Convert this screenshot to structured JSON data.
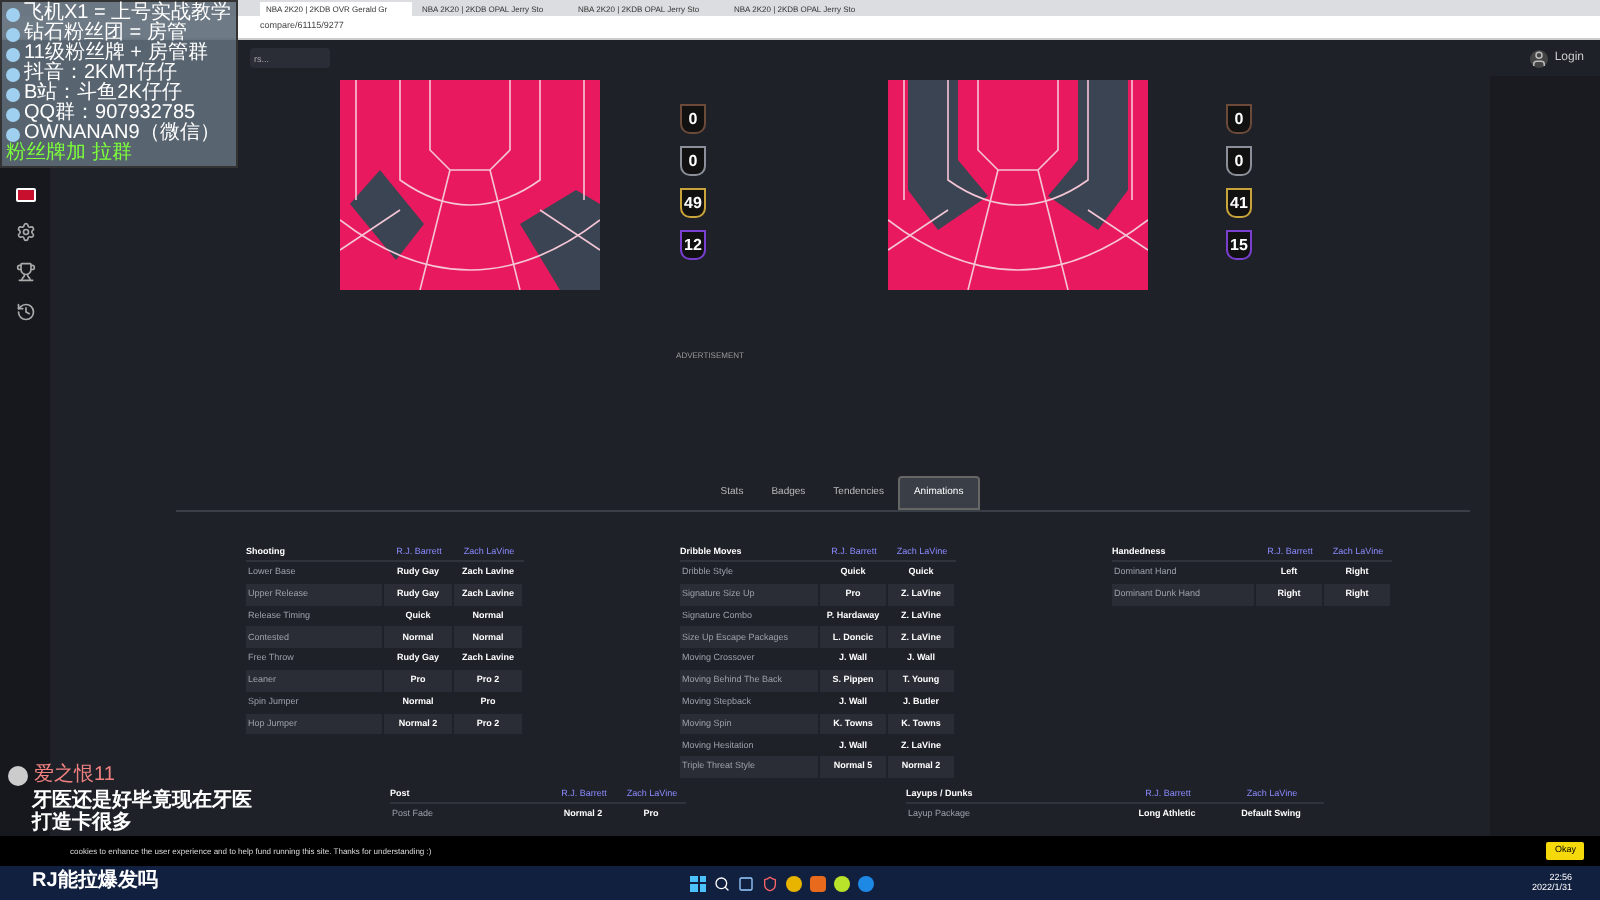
{
  "browser": {
    "tabs": [
      {
        "label": "NBA 2K20 | 2KDB OVR Gerald Gr",
        "selected": true
      },
      {
        "label": "NBA 2K20 | 2KDB OPAL Jerry Sto",
        "selected": false
      },
      {
        "label": "NBA 2K20 | 2KDB OPAL Jerry Sto",
        "selected": false
      },
      {
        "label": "NBA 2K20 | 2KDB OPAL Jerry Sto",
        "selected": false
      }
    ],
    "url": "compare/61115/9277"
  },
  "header": {
    "search": {
      "placeholder": "rs..."
    },
    "login": "Login"
  },
  "players": [
    {
      "badges": [
        {
          "count": "0",
          "color": "#6b4a3a"
        },
        {
          "count": "0",
          "color": "#8a8f99"
        },
        {
          "count": "49",
          "color": "#c9a43a"
        },
        {
          "count": "12",
          "color": "#7a3fd1"
        }
      ]
    },
    {
      "badges": [
        {
          "count": "0",
          "color": "#6b4a3a"
        },
        {
          "count": "0",
          "color": "#8a8f99"
        },
        {
          "count": "41",
          "color": "#c9a43a"
        },
        {
          "count": "15",
          "color": "#7a3fd1"
        }
      ]
    }
  ],
  "advertisement": "ADVERTISEMENT",
  "tabs": [
    {
      "label": "Stats",
      "selected": false
    },
    {
      "label": "Badges",
      "selected": false
    },
    {
      "label": "Tendencies",
      "selected": false
    },
    {
      "label": "Animations",
      "selected": true
    }
  ],
  "tables": [
    {
      "title": "Shooting",
      "players": [
        "R.J. Barrett",
        "Zach LaVine"
      ],
      "rows": [
        {
          "label": "Lower Base",
          "values": [
            "Rudy Gay",
            "Zach Lavine"
          ]
        },
        {
          "label": "Upper Release",
          "values": [
            "Rudy Gay",
            "Zach Lavine"
          ]
        },
        {
          "label": "Release Timing",
          "values": [
            "Quick",
            "Normal"
          ]
        },
        {
          "label": "Contested",
          "values": [
            "Normal",
            "Normal"
          ]
        },
        {
          "label": "Free Throw",
          "values": [
            "Rudy Gay",
            "Zach Lavine"
          ]
        },
        {
          "label": "Leaner",
          "values": [
            "Pro",
            "Pro 2"
          ]
        },
        {
          "label": "Spin Jumper",
          "values": [
            "Normal",
            "Pro"
          ]
        },
        {
          "label": "Hop Jumper",
          "values": [
            "Normal 2",
            "Pro 2"
          ]
        }
      ]
    },
    {
      "title": "Dribble Moves",
      "players": [
        "R.J. Barrett",
        "Zach LaVine"
      ],
      "rows": [
        {
          "label": "Dribble Style",
          "values": [
            "Quick",
            "Quick"
          ]
        },
        {
          "label": "Signature Size Up",
          "values": [
            "Pro",
            "Z. LaVine"
          ]
        },
        {
          "label": "Signature Combo",
          "values": [
            "P. Hardaway",
            "Z. LaVine"
          ]
        },
        {
          "label": "Size Up Escape Packages",
          "values": [
            "L. Doncic",
            "Z. LaVine"
          ]
        },
        {
          "label": "Moving Crossover",
          "values": [
            "J. Wall",
            "J. Wall"
          ]
        },
        {
          "label": "Moving Behind The Back",
          "values": [
            "S. Pippen",
            "T. Young"
          ]
        },
        {
          "label": "Moving Stepback",
          "values": [
            "J. Wall",
            "J. Butler"
          ]
        },
        {
          "label": "Moving Spin",
          "values": [
            "K. Towns",
            "K. Towns"
          ]
        },
        {
          "label": "Moving Hesitation",
          "values": [
            "J. Wall",
            "Z. LaVine"
          ]
        },
        {
          "label": "Triple Threat Style",
          "values": [
            "Normal 5",
            "Normal 2"
          ]
        }
      ]
    },
    {
      "title": "Handedness",
      "players": [
        "R.J. Barrett",
        "Zach LaVine"
      ],
      "rows": [
        {
          "label": "Dominant Hand",
          "values": [
            "Left",
            "Right"
          ]
        },
        {
          "label": "Dominant Dunk Hand",
          "values": [
            "Right",
            "Right"
          ]
        }
      ]
    },
    {
      "title": "Post",
      "players": [
        "R.J. Barrett",
        "Zach LaVine"
      ],
      "rows": [
        {
          "label": "Post Fade",
          "values": [
            "Normal 2",
            "Pro"
          ]
        }
      ]
    },
    {
      "title": "Layups / Dunks",
      "players": [
        "R.J. Barrett",
        "Zach LaVine"
      ],
      "rows": [
        {
          "label": "Layup Package",
          "values": [
            "Long Athletic",
            "Default Swing"
          ]
        }
      ]
    }
  ],
  "cookie_banner": {
    "text": "cookies to enhance the user experience and to help fund running this site. Thanks for understanding :)",
    "button": "Okay"
  },
  "stream_overlay": {
    "lines": [
      "飞机X1 = 上号实战教学",
      "钻石粉丝团 = 房管",
      "11级粉丝牌 + 房管群",
      "抖音：2KMT仔仔",
      "B站：斗鱼2K仔仔",
      "QQ群：907932785",
      "OWNANAN9（微信）"
    ],
    "note": "粉丝牌加 拉群"
  },
  "chat": {
    "user": "爱之恨11",
    "messages": [
      "牙医还是好毕竟现在牙医",
      "打造卡很多",
      "RJ能拉爆发吗"
    ]
  },
  "taskbar": {
    "time": "22:56",
    "date": "2022/1/31"
  }
}
